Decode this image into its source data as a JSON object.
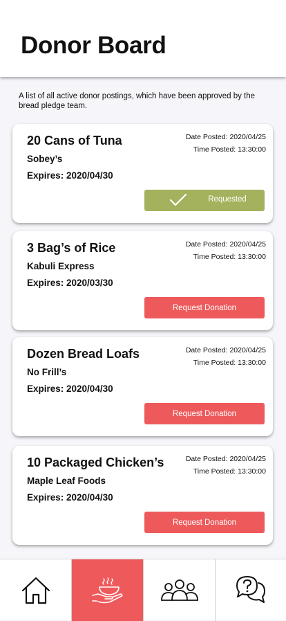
{
  "header": {
    "title": "Donor Board"
  },
  "intro": "A list of all active donor postings, which have been approved by the bread pledge team.",
  "cards": [
    {
      "title": "20 Cans of Tuna",
      "donor": "Sobey’s",
      "expires": "Expires: 2020/04/30",
      "date_posted": "Date Posted: 2020/04/25",
      "time_posted": "Time Posted: 13:30:00",
      "button_label": "Requested",
      "status": "requested"
    },
    {
      "title": "3 Bag’s of Rice",
      "donor": "Kabuli Express",
      "expires": "Expires: 2020/03/30",
      "date_posted": "Date Posted: 2020/04/25",
      "time_posted": "Time Posted: 13:30:00",
      "button_label": "Request Donation",
      "status": "open"
    },
    {
      "title": "Dozen Bread Loafs",
      "donor": "No Frill’s",
      "expires": "Expires: 2020/04/30",
      "date_posted": "Date Posted: 2020/04/25",
      "time_posted": "Time Posted: 13:30:00",
      "button_label": "Request Donation",
      "status": "open"
    },
    {
      "title": "10 Packaged Chicken’s",
      "donor": "Maple Leaf Foods",
      "expires": "Expires: 2020/04/30",
      "date_posted": "Date Posted: 2020/04/25",
      "time_posted": "Time Posted: 13:30:00",
      "button_label": "Request Donation",
      "status": "open"
    }
  ],
  "nav": {
    "items": [
      {
        "icon": "home-icon",
        "active": false
      },
      {
        "icon": "food-donation-icon",
        "active": true
      },
      {
        "icon": "community-icon",
        "active": false
      },
      {
        "icon": "help-chat-icon",
        "active": false
      }
    ]
  },
  "colors": {
    "accent": "#ee5a5c",
    "requested": "#a5b25d",
    "background": "#f6f6fa"
  }
}
